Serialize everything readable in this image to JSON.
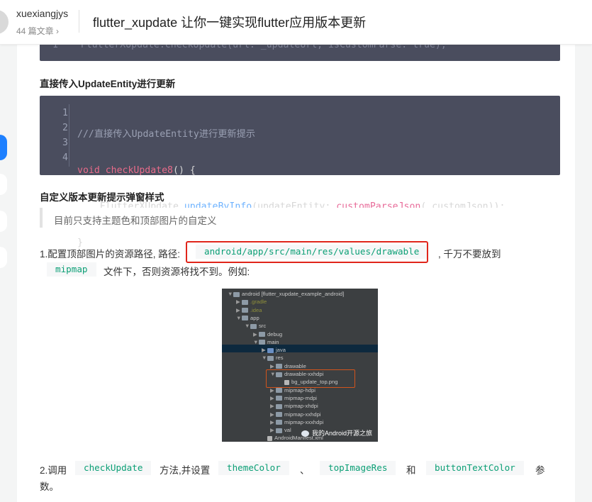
{
  "header": {
    "author": "xuexiangjys",
    "article_count": "44 篇文章 ›",
    "title": "flutter_xupdate 让你一键实现flutter应用版本更新"
  },
  "top_code": {
    "line_number": "1",
    "text": "FlutterXUpdate.checkUpdate(url: _updateUrl, isCustomParse: true);"
  },
  "section1": {
    "heading": "直接传入UpdateEntity进行更新"
  },
  "code": {
    "line_numbers": [
      "1",
      "2",
      "3",
      "4"
    ],
    "line1": "///直接传入UpdateEntity进行更新提示",
    "line2_kw": "void",
    "line2_fn": "checkUpdate8",
    "line2_rest": "() {",
    "line3_indent": "    ",
    "line3_obj": "FlutterXUpdate.",
    "line3_method": "updateByInfo",
    "line3_a": "(updateEntity: ",
    "line3_param": "customParseJson",
    "line3_b": "(_customJson));",
    "line4": "}"
  },
  "section2": {
    "heading": "自定义版本更新提示弹窗样式",
    "quote": "目前只支持主题色和顶部图片的自定义"
  },
  "step1": {
    "prefix": "1.配置顶部图片的资源路径, 路径:",
    "path_code": "android/app/src/main/res/values/drawable",
    "suffix": ", 千万不要放到",
    "mipmap_code": "mipmap",
    "tail": "文件下，否则资源将找不到。例如:"
  },
  "figure": {
    "rows": [
      {
        "label": "android [flutter_xupdate_example_android]",
        "arrow": "▼"
      },
      {
        "label": ".gradle",
        "arrow": "▶",
        "ignored": true
      },
      {
        "label": ".idea",
        "arrow": "▶",
        "ignored": true
      },
      {
        "label": "app",
        "arrow": "▼"
      },
      {
        "label": "src",
        "arrow": "▼"
      },
      {
        "label": "debug",
        "arrow": "▶"
      },
      {
        "label": "main",
        "arrow": "▼"
      },
      {
        "label": "java",
        "arrow": "▶",
        "blue": true
      },
      {
        "label": "res",
        "arrow": "▼"
      },
      {
        "label": "drawable",
        "arrow": "▶"
      },
      {
        "label": "drawable-xxhdpi",
        "arrow": "▼"
      },
      {
        "label": "bg_update_top.png",
        "arrow": "",
        "file": true
      },
      {
        "label": "mipmap-hdpi",
        "arrow": "▶"
      },
      {
        "label": "mipmap-mdpi",
        "arrow": "▶"
      },
      {
        "label": "mipmap-xhdpi",
        "arrow": "▶"
      },
      {
        "label": "mipmap-xxhdpi",
        "arrow": "▶"
      },
      {
        "label": "mipmap-xxxhdpi",
        "arrow": "▶"
      },
      {
        "label": "val",
        "arrow": "▶"
      },
      {
        "label": "AndroidManifest.xml",
        "arrow": "",
        "file": true
      }
    ],
    "watermark": "我的Android开源之旅"
  },
  "step2": {
    "prefix": "2.调用",
    "code1": "checkUpdate",
    "mid1": "方法,并设置",
    "code2": "themeColor",
    "sep": "、",
    "code3": "topImageRes",
    "and": "和",
    "code4": "buttonTextColor",
    "tail": "参",
    "tail2": "数。"
  }
}
